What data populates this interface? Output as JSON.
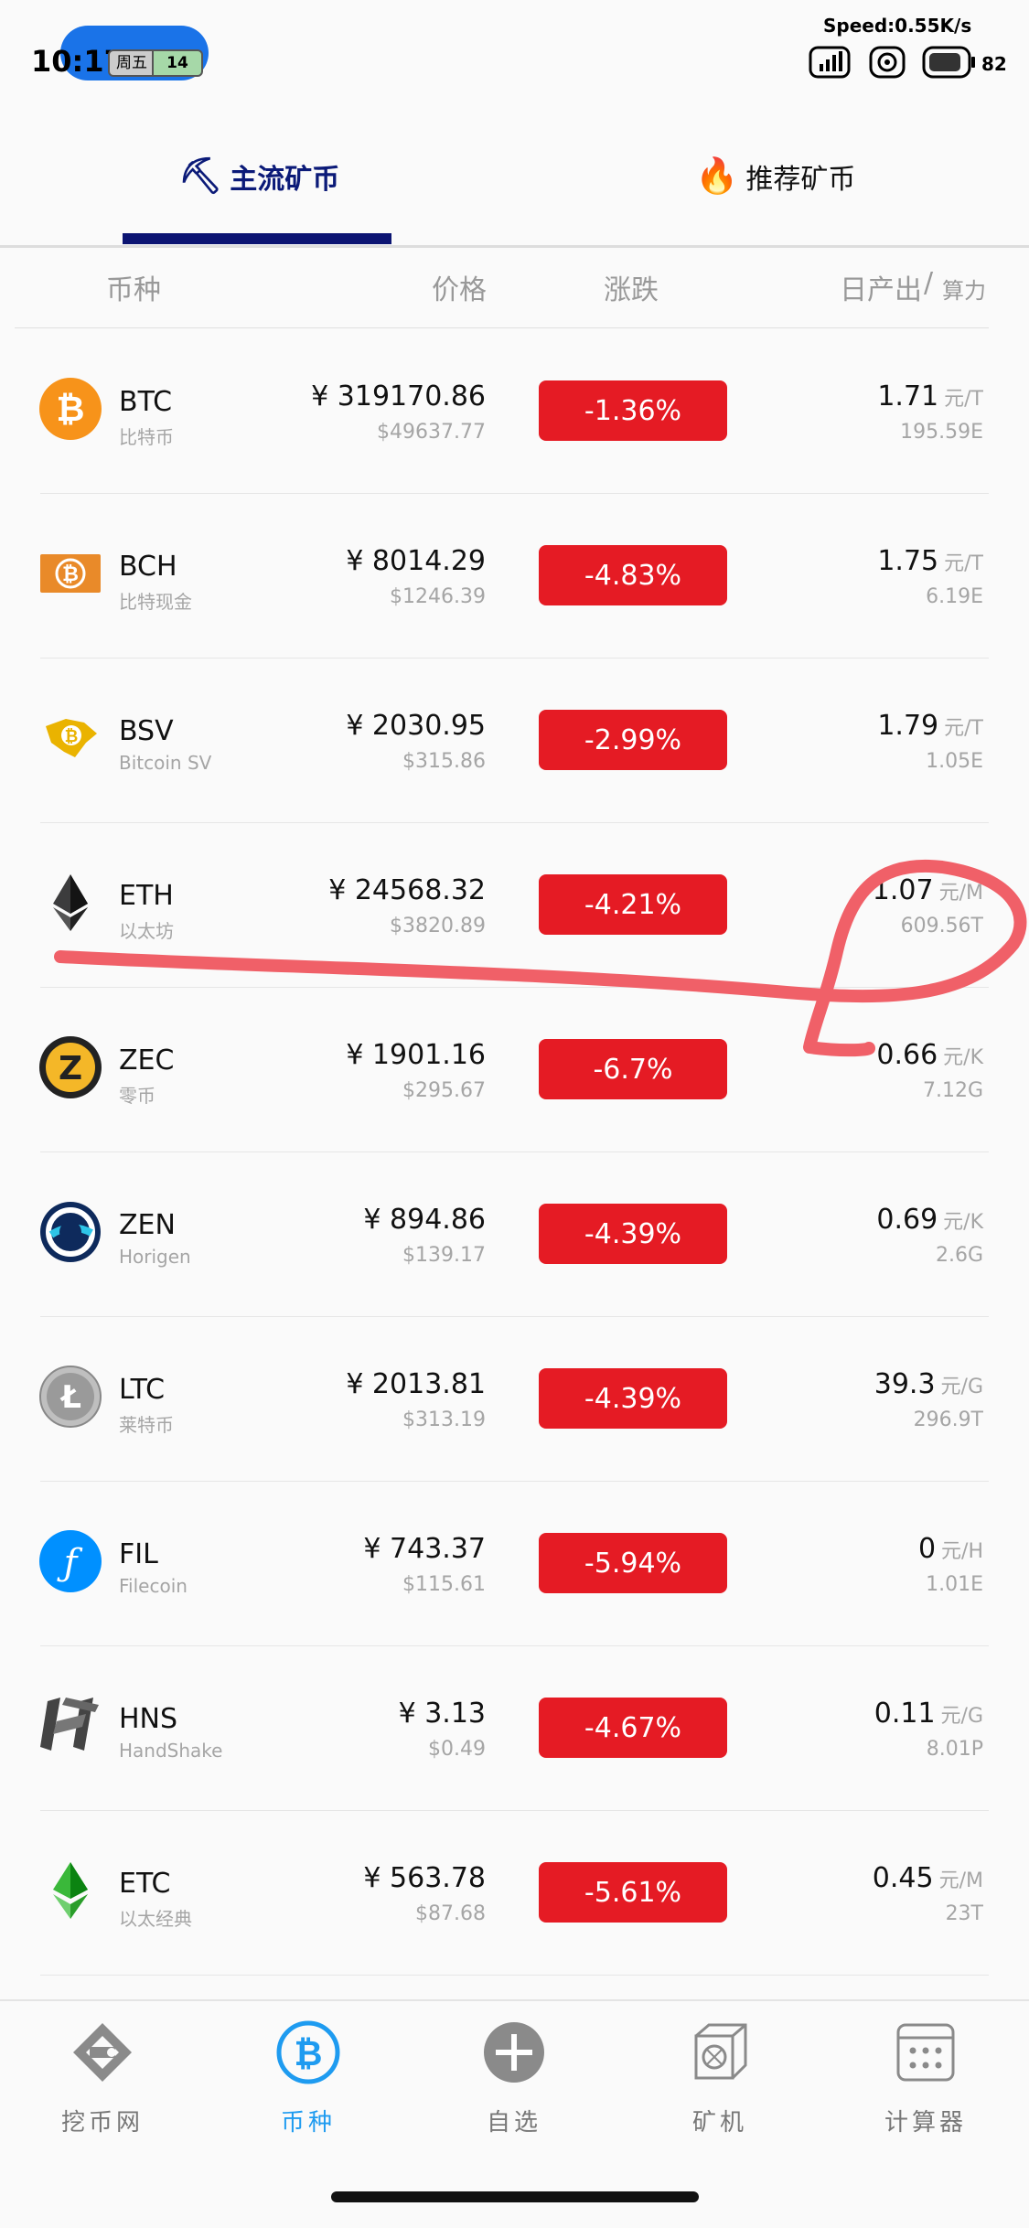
{
  "status_bar": {
    "time": "10:17",
    "weekday": "周五",
    "day": "14",
    "speed": "Speed:0.55K/s",
    "battery": "82"
  },
  "tabs": [
    {
      "label": "主流矿币",
      "icon": "pickaxe-icon",
      "active": true
    },
    {
      "label": "推荐矿币",
      "icon": "fire-icon",
      "active": false
    }
  ],
  "columns": {
    "coin": "币种",
    "price": "价格",
    "change": "涨跌",
    "output": "日产出",
    "slash": "/",
    "hashrate": "算力"
  },
  "coins": [
    {
      "symbol": "BTC",
      "name": "比特币",
      "cny": "¥ 319170.86",
      "usd": "$49637.77",
      "change": "-1.36%",
      "output": "1.71",
      "unit": "元/T",
      "hashrate": "195.59E",
      "icon": "btc-icon"
    },
    {
      "symbol": "BCH",
      "name": "比特现金",
      "cny": "¥ 8014.29",
      "usd": "$1246.39",
      "change": "-4.83%",
      "output": "1.75",
      "unit": "元/T",
      "hashrate": "6.19E",
      "icon": "bch-icon"
    },
    {
      "symbol": "BSV",
      "name": "Bitcoin SV",
      "cny": "¥ 2030.95",
      "usd": "$315.86",
      "change": "-2.99%",
      "output": "1.79",
      "unit": "元/T",
      "hashrate": "1.05E",
      "icon": "bsv-icon"
    },
    {
      "symbol": "ETH",
      "name": "以太坊",
      "cny": "¥ 24568.32",
      "usd": "$3820.89",
      "change": "-4.21%",
      "output": "1.07",
      "unit": "元/M",
      "hashrate": "609.56T",
      "icon": "eth-icon"
    },
    {
      "symbol": "ZEC",
      "name": "零币",
      "cny": "¥ 1901.16",
      "usd": "$295.67",
      "change": "-6.7%",
      "output": "0.66",
      "unit": "元/K",
      "hashrate": "7.12G",
      "icon": "zec-icon"
    },
    {
      "symbol": "ZEN",
      "name": "Horigen",
      "cny": "¥ 894.86",
      "usd": "$139.17",
      "change": "-4.39%",
      "output": "0.69",
      "unit": "元/K",
      "hashrate": "2.6G",
      "icon": "zen-icon"
    },
    {
      "symbol": "LTC",
      "name": "莱特币",
      "cny": "¥ 2013.81",
      "usd": "$313.19",
      "change": "-4.39%",
      "output": "39.3",
      "unit": "元/G",
      "hashrate": "296.9T",
      "icon": "ltc-icon"
    },
    {
      "symbol": "FIL",
      "name": "Filecoin",
      "cny": "¥ 743.37",
      "usd": "$115.61",
      "change": "-5.94%",
      "output": "0",
      "unit": "元/H",
      "hashrate": "1.01E",
      "icon": "fil-icon"
    },
    {
      "symbol": "HNS",
      "name": "HandShake",
      "cny": "¥ 3.13",
      "usd": "$0.49",
      "change": "-4.67%",
      "output": "0.11",
      "unit": "元/G",
      "hashrate": "8.01P",
      "icon": "hns-icon"
    },
    {
      "symbol": "ETC",
      "name": "以太经典",
      "cny": "¥ 563.78",
      "usd": "$87.68",
      "change": "-5.61%",
      "output": "0.45",
      "unit": "元/M",
      "hashrate": "23T",
      "icon": "etc-icon"
    }
  ],
  "colors": {
    "down": "#e51b24",
    "tab_active": "#0b1a78",
    "nav_active": "#1e9bf0",
    "annotation": "#f06068"
  },
  "bottom_nav": [
    {
      "label": "挖币网",
      "icon": "wabi-logo-icon",
      "active": false
    },
    {
      "label": "币种",
      "icon": "bitcoin-icon",
      "active": true
    },
    {
      "label": "自选",
      "icon": "plus-circle-icon",
      "active": false
    },
    {
      "label": "矿机",
      "icon": "miner-icon",
      "active": false
    },
    {
      "label": "计算器",
      "icon": "calculator-icon",
      "active": false
    }
  ]
}
